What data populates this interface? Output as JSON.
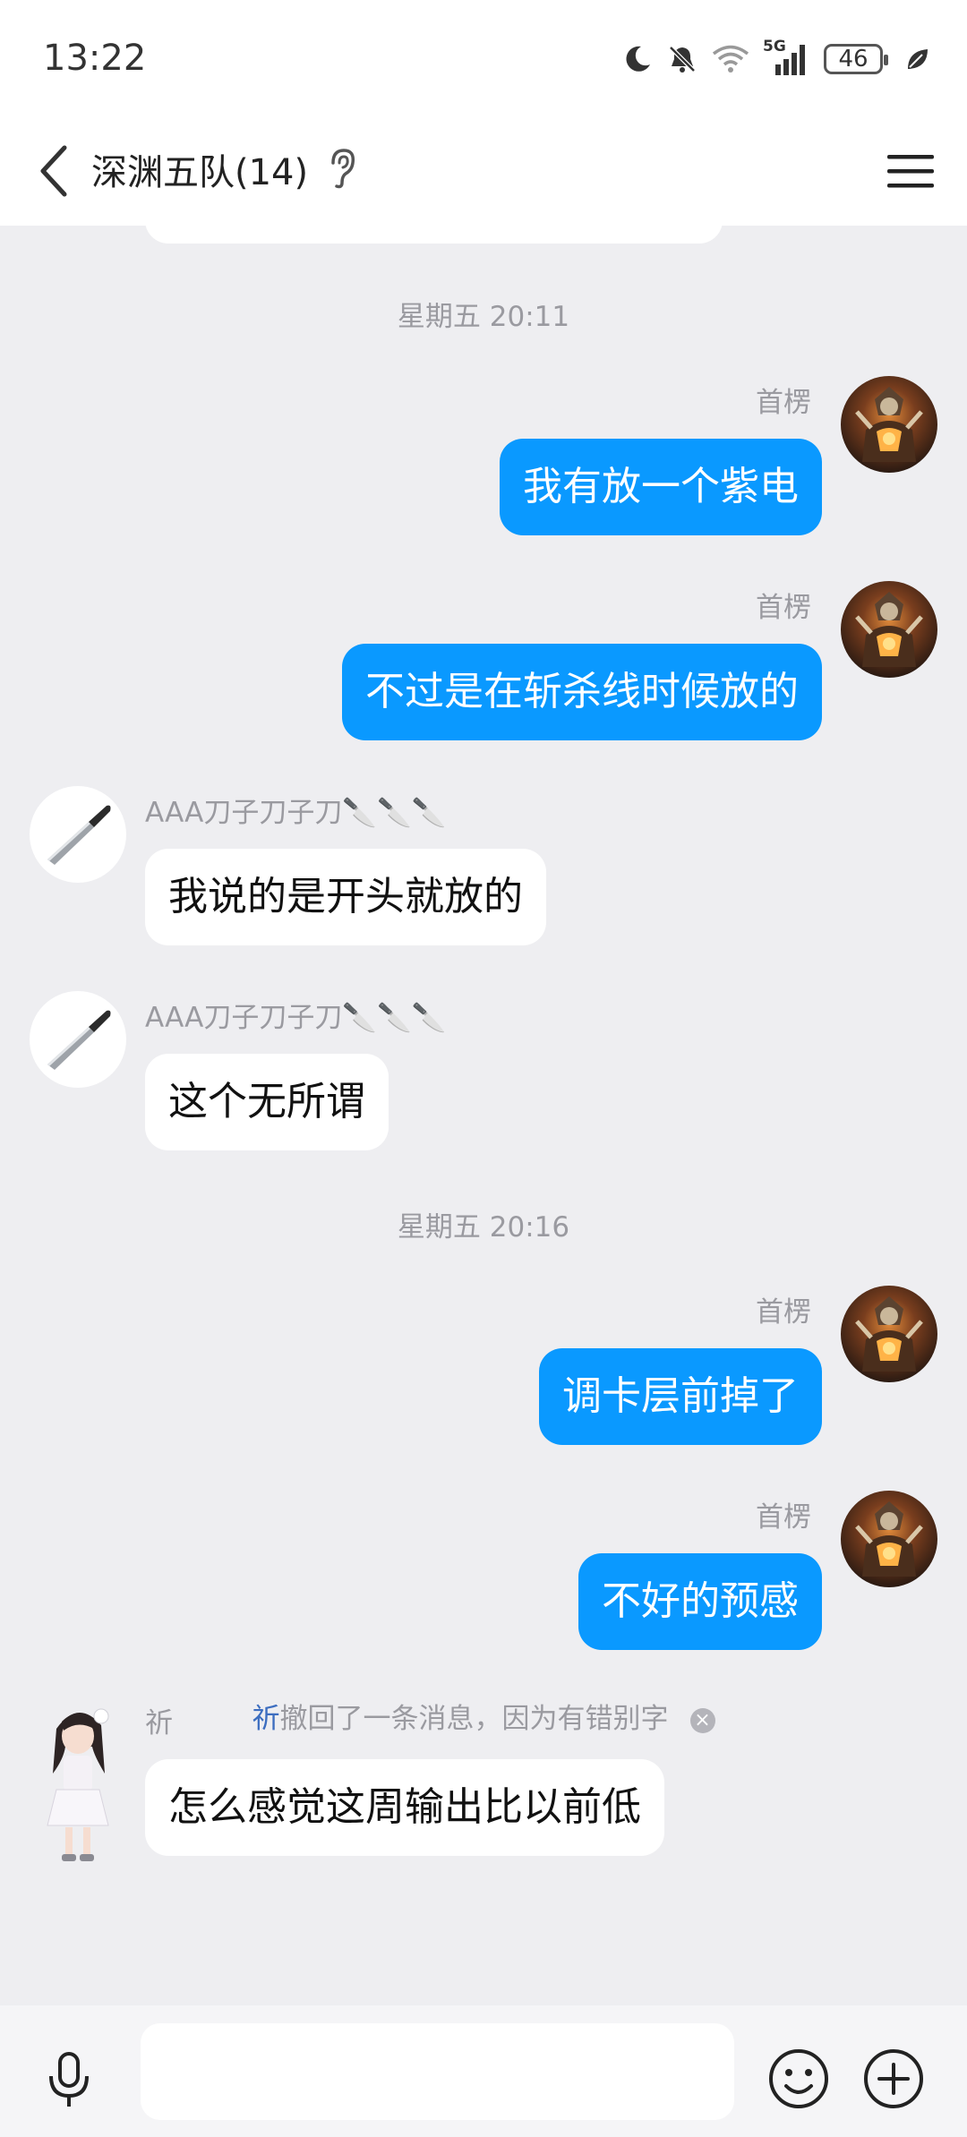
{
  "status_bar": {
    "time": "13:22",
    "network": "5G",
    "battery": "46",
    "icons": [
      "moon-icon",
      "bell-muted-icon",
      "wifi-icon",
      "signal-icon",
      "battery-icon",
      "leaf-icon"
    ]
  },
  "header": {
    "title": "深渊五队(14)",
    "icons": [
      "back-arrow-icon",
      "ear-icon",
      "menu-icon"
    ]
  },
  "chat": {
    "time_separators": [
      "星期五 20:11",
      "星期五 20:16"
    ],
    "messages": [
      {
        "sender": "首楞",
        "text": "我有放一个紫电",
        "direction": "outgoing"
      },
      {
        "sender": "首楞",
        "text": "不过是在斩杀线时候放的",
        "direction": "outgoing"
      },
      {
        "sender": "AAA刀子刀子刀🔪🔪🔪",
        "text": "我说的是开头就放的",
        "direction": "incoming"
      },
      {
        "sender": "AAA刀子刀子刀🔪🔪🔪",
        "text": "这个无所谓",
        "direction": "incoming"
      },
      {
        "sender": "首楞",
        "text": "调卡层前掉了",
        "direction": "outgoing"
      },
      {
        "sender": "首楞",
        "text": "不好的预感",
        "direction": "outgoing"
      },
      {
        "sender": "祈",
        "text": "怎么感觉这周输出比以前低",
        "direction": "incoming"
      }
    ],
    "recall_notice": {
      "name": "祈",
      "text": "撤回了一条消息，因为有错别字"
    }
  },
  "input_bar": {
    "value": "",
    "icons": [
      "microphone-icon",
      "emoji-icon",
      "plus-icon"
    ]
  },
  "colors": {
    "accent": "#0a99ff",
    "chat_background": "#eeeef1",
    "recall_name": "#3d6ec0"
  }
}
